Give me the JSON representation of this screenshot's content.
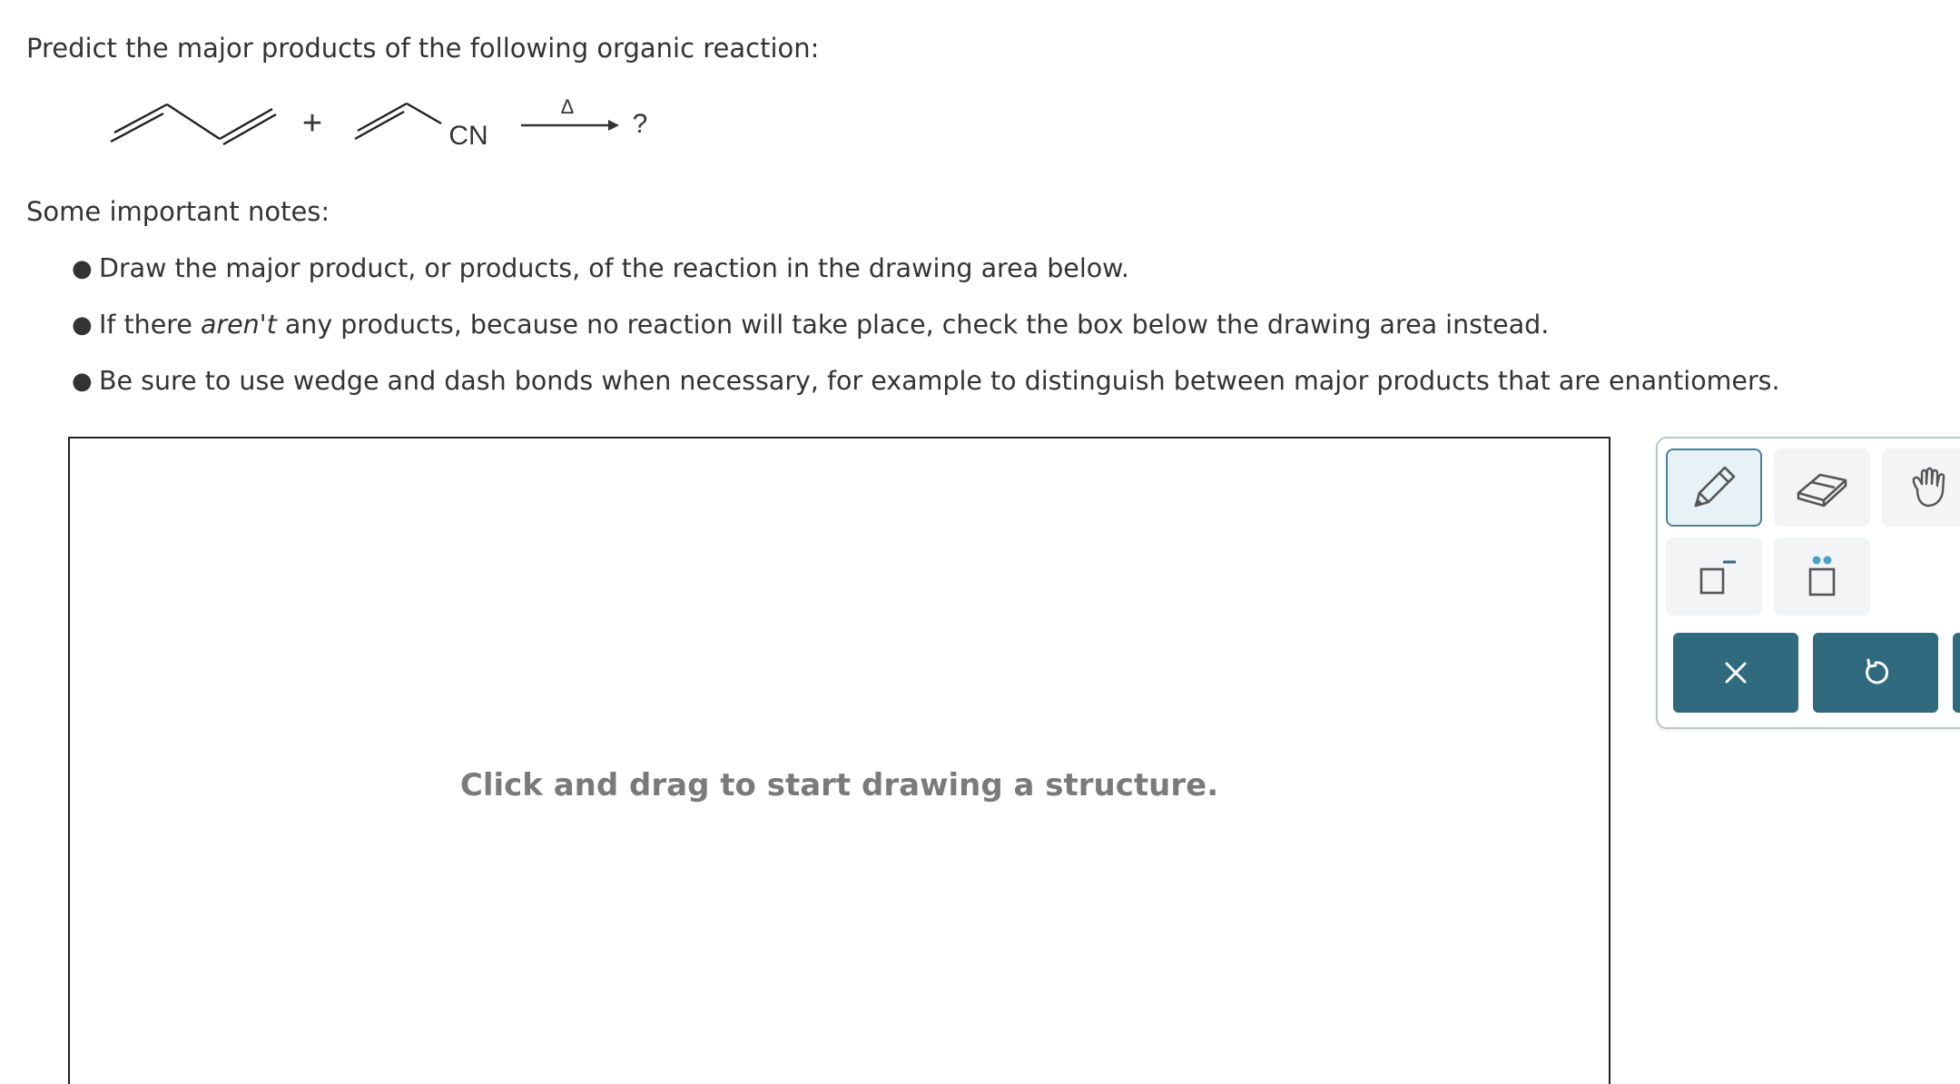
{
  "question": {
    "prompt": "Predict the major products of the following organic reaction:"
  },
  "reaction": {
    "plus": "+",
    "reagent_group": "CN",
    "condition": "Δ",
    "product": "?"
  },
  "notes": {
    "heading": "Some important notes:",
    "items": [
      {
        "text_before": "Draw the major product, or products, of the reaction in the drawing area below.",
        "emphasis": "",
        "text_after": ""
      },
      {
        "text_before": "If there ",
        "emphasis": "aren't",
        "text_after": " any products, because no reaction will take place, check the box below the drawing area instead."
      },
      {
        "text_before": "Be sure to use wedge and dash bonds when necessary, for example to distinguish between major products that are enantiomers.",
        "emphasis": "",
        "text_after": ""
      }
    ]
  },
  "canvas": {
    "hint": "Click and drag to start drawing a structure."
  },
  "toolbar": {
    "tools": [
      {
        "name": "pencil-icon",
        "active": true
      },
      {
        "name": "eraser-icon",
        "active": false
      },
      {
        "name": "hand-icon",
        "active": false
      },
      {
        "name": "charge-icon",
        "active": false
      },
      {
        "name": "lone-pair-icon",
        "active": false
      }
    ],
    "actions": [
      {
        "name": "clear-icon"
      },
      {
        "name": "undo-icon"
      }
    ],
    "colors": {
      "accent": "#2f6a7e",
      "active_bg": "#e6f2f6",
      "lone_pair": "#4aa3c4"
    }
  }
}
